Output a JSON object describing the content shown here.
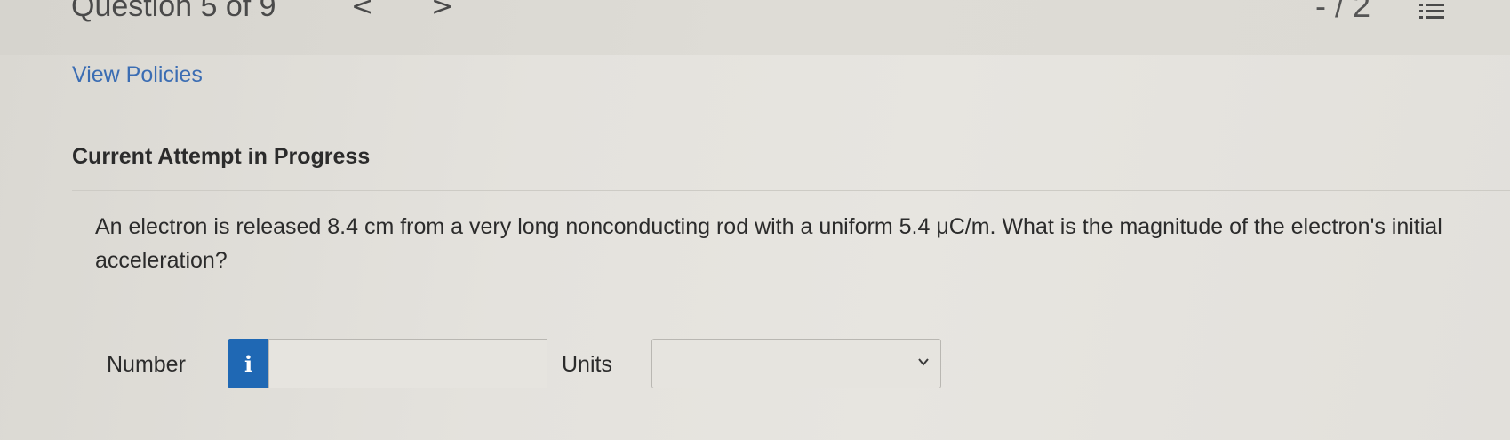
{
  "header": {
    "question_nav": "Question 5 of 9",
    "prev_arrow": "<",
    "next_arrow": ">",
    "score": "- / 2",
    "list_icon": "list-icon"
  },
  "links": {
    "view_policies": "View Policies"
  },
  "attempt": {
    "heading": "Current Attempt in Progress"
  },
  "question": {
    "text": "An electron is released 8.4 cm from a very long nonconducting rod with a uniform 5.4 μC/m. What is the magnitude of the electron's initial acceleration?"
  },
  "answer": {
    "number_label": "Number",
    "info_icon": "i",
    "number_value": "",
    "units_label": "Units",
    "units_value": ""
  },
  "colors": {
    "link": "#3b6db3",
    "info_button": "#1f68b4",
    "text": "#2b2b2b"
  }
}
